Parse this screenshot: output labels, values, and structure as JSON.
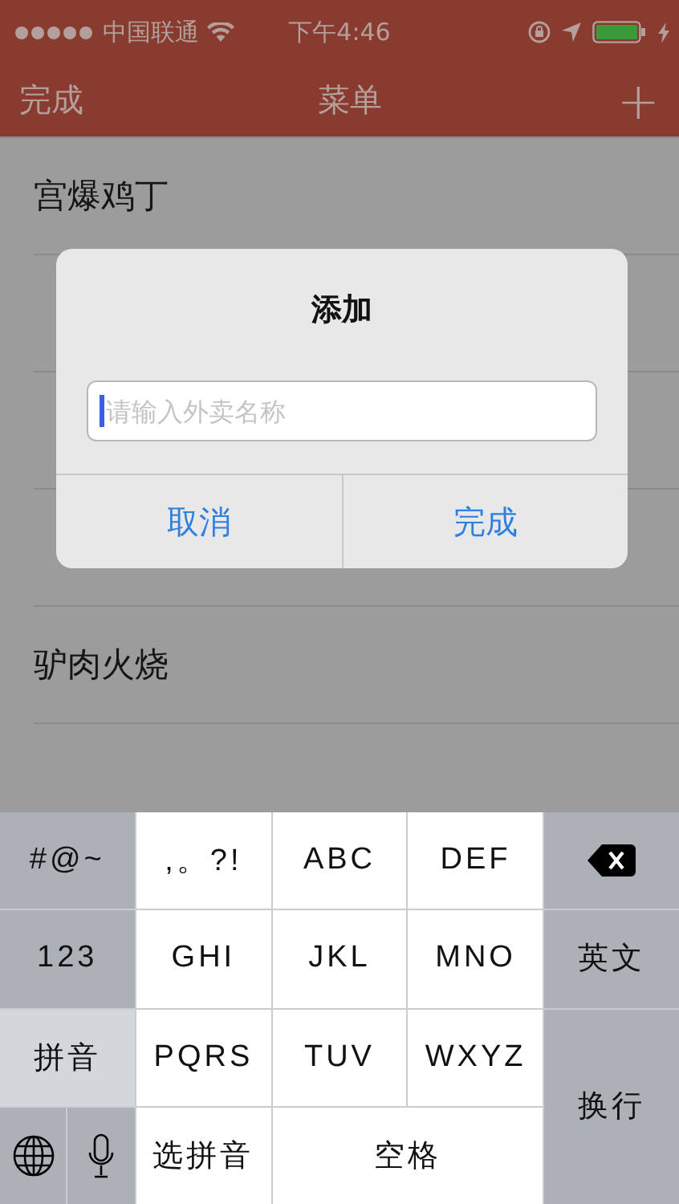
{
  "status_bar": {
    "carrier": "中国联通",
    "time": "下午4:46"
  },
  "nav_bar": {
    "left_button": "完成",
    "title": "菜单",
    "right_button": "+"
  },
  "list": {
    "items": [
      {
        "kind": "text",
        "label": "宫爆鸡丁"
      },
      {
        "kind": "covered"
      },
      {
        "kind": "covered"
      },
      {
        "kind": "covered"
      },
      {
        "kind": "text",
        "label": "驴肉火烧"
      }
    ]
  },
  "dialog": {
    "title": "添加",
    "input": {
      "placeholder": "请输入外卖名称"
    },
    "buttons": [
      {
        "label": "取消",
        "kind": "cancel"
      },
      {
        "label": "完成",
        "kind": "confirm"
      }
    ]
  },
  "keyboard": {
    "keys": [
      {
        "label": "#@~",
        "kind": "function"
      },
      {
        "label": ",。?!",
        "kind": "letter"
      },
      {
        "label": "ABC",
        "kind": "letter"
      },
      {
        "label": "DEF",
        "kind": "letter"
      },
      {
        "kind": "delete"
      },
      {
        "label": "123",
        "kind": "function"
      },
      {
        "label": "GHI",
        "kind": "letter"
      },
      {
        "label": "JKL",
        "kind": "letter"
      },
      {
        "label": "MNO",
        "kind": "letter"
      },
      {
        "label": "英文",
        "kind": "function"
      },
      {
        "label": "拼音",
        "kind": "mode"
      },
      {
        "label": "PQRS",
        "kind": "letter"
      },
      {
        "label": "TUV",
        "kind": "letter"
      },
      {
        "label": "WXYZ",
        "kind": "letter"
      },
      {
        "label": "换行",
        "kind": "return"
      },
      {
        "kind": "globe"
      },
      {
        "kind": "mic"
      },
      {
        "label": "选拼音",
        "kind": "letter"
      },
      {
        "label": "空格",
        "kind": "space"
      }
    ]
  }
}
